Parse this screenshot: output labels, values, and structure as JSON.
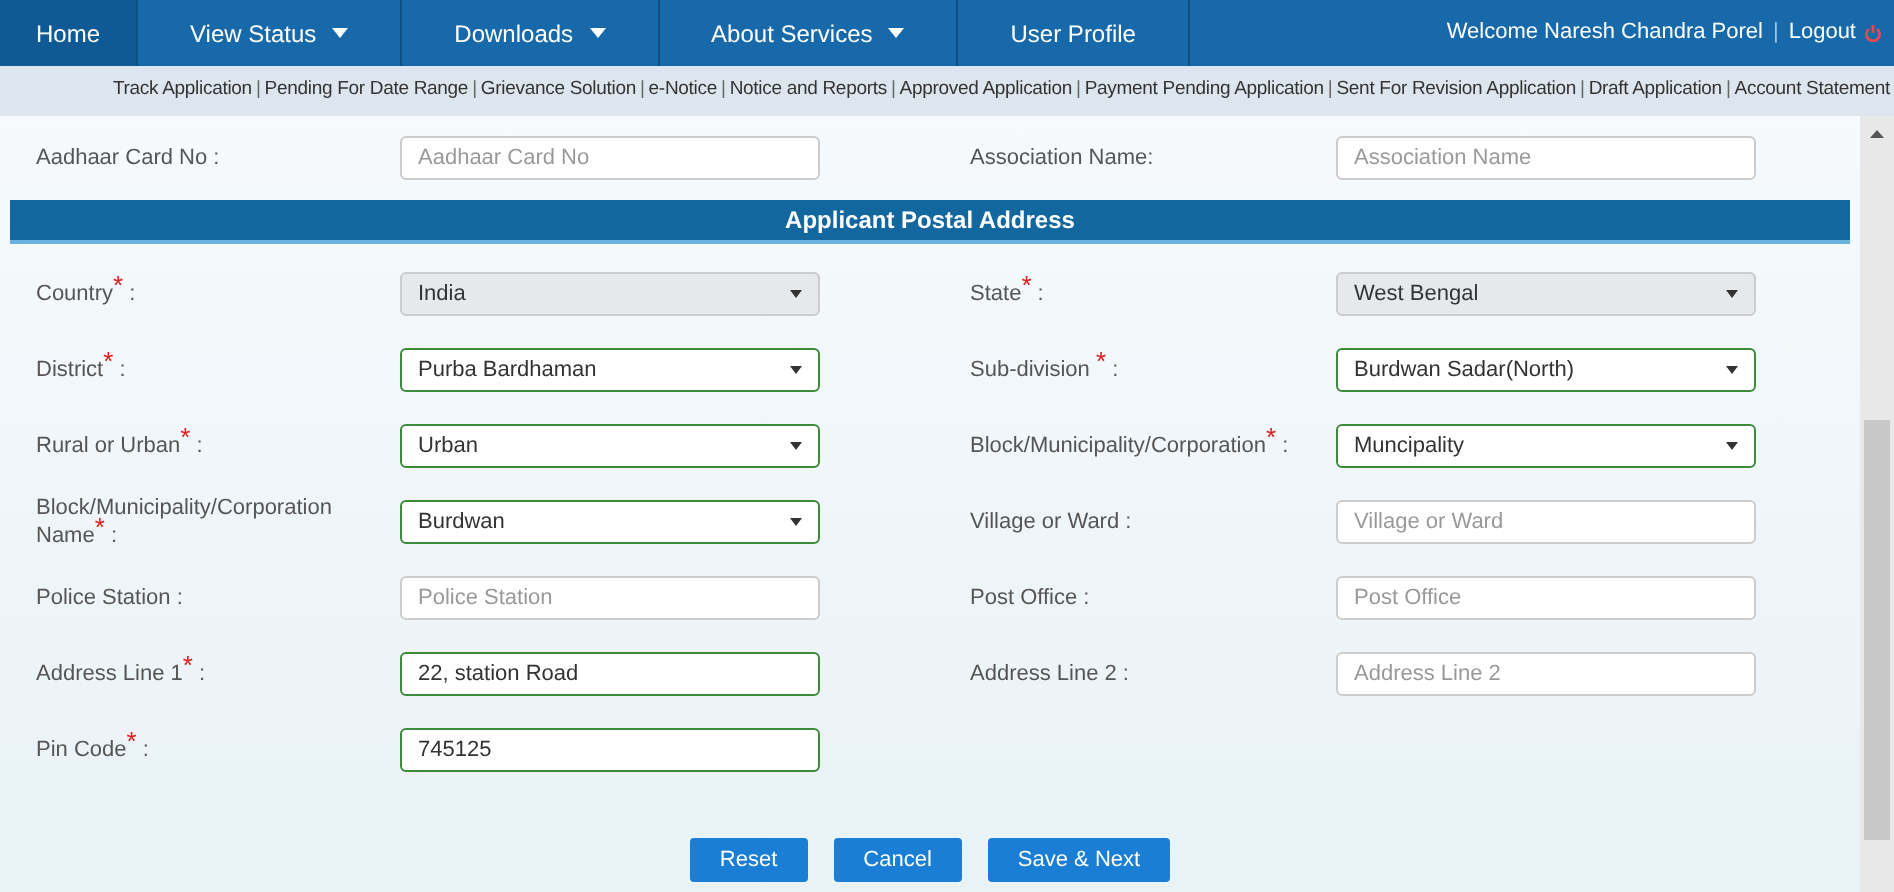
{
  "nav": {
    "items": [
      {
        "label": "Home",
        "selected": true,
        "dropdown": false
      },
      {
        "label": "View Status",
        "selected": false,
        "dropdown": true
      },
      {
        "label": "Downloads",
        "selected": false,
        "dropdown": true
      },
      {
        "label": "About Services",
        "selected": false,
        "dropdown": true
      },
      {
        "label": "User Profile",
        "selected": false,
        "dropdown": false
      }
    ],
    "welcome": "Welcome Naresh Chandra Porel",
    "separator": "|",
    "logout": "Logout"
  },
  "subnav": [
    "Track Application",
    "Pending For Date Range",
    "Grievance Solution",
    "e-Notice",
    "Notice and Reports",
    "Approved Application",
    "Payment Pending Application",
    "Sent For Revision Application",
    "Draft Application",
    "Account Statement"
  ],
  "top_row": [
    {
      "label": "Aadhaar Card No :",
      "field": {
        "kind": "input",
        "placeholder": "Aadhaar Card No",
        "valid": false,
        "disabled": false
      }
    },
    {
      "label": "Association Name:",
      "field": {
        "kind": "input",
        "placeholder": "Association Name",
        "valid": false,
        "disabled": false
      }
    }
  ],
  "section": {
    "title": "Applicant Postal Address",
    "rows": [
      [
        {
          "label": "Country$^{*}$ :",
          "field": {
            "kind": "select",
            "value": "India",
            "valid": false,
            "disabled": true
          }
        },
        {
          "label": "State$^{*}$ :",
          "field": {
            "kind": "select",
            "value": "West Bengal",
            "valid": false,
            "disabled": true
          }
        }
      ],
      [
        {
          "label": "District$^{*}$ :",
          "field": {
            "kind": "select",
            "value": "Purba Bardhaman",
            "valid": true,
            "disabled": false
          }
        },
        {
          "label": "Sub-division $^{*}$ :",
          "field": {
            "kind": "select",
            "value": "Burdwan Sadar(North)",
            "valid": true,
            "disabled": false
          }
        }
      ],
      [
        {
          "label": "Rural or Urban$^{*}$ :",
          "field": {
            "kind": "select",
            "value": "Urban",
            "valid": true,
            "disabled": false
          }
        },
        {
          "label": "Block/Municipality/Corporation$^{*}$ :",
          "field": {
            "kind": "select",
            "value": "Muncipality",
            "valid": true,
            "disabled": false
          }
        }
      ],
      [
        {
          "label": "Block/Municipality/Corporation Name$^{*}$ :",
          "field": {
            "kind": "select",
            "value": "Burdwan",
            "valid": true,
            "disabled": false
          }
        },
        {
          "label": "Village or Ward :",
          "field": {
            "kind": "input",
            "placeholder": "Village or Ward",
            "valid": false,
            "disabled": false
          }
        }
      ],
      [
        {
          "label": "Police Station  :",
          "field": {
            "kind": "input",
            "placeholder": "Police Station",
            "valid": false,
            "disabled": false
          }
        },
        {
          "label": "Post Office :",
          "field": {
            "kind": "input",
            "placeholder": "Post Office",
            "valid": false,
            "disabled": false
          }
        }
      ],
      [
        {
          "label": "Address Line 1$^{*}$ :",
          "field": {
            "kind": "input",
            "value": "22, station Road",
            "valid": true,
            "disabled": false
          }
        },
        {
          "label": "Address Line 2 :",
          "field": {
            "kind": "input",
            "placeholder": "Address Line 2",
            "valid": false,
            "disabled": false
          }
        }
      ],
      [
        {
          "label": "Pin Code$^{*}$ :",
          "field": {
            "kind": "input",
            "value": "745125",
            "valid": true,
            "disabled": false
          }
        }
      ]
    ]
  },
  "buttons": [
    "Reset",
    "Cancel",
    "Save & Next"
  ]
}
